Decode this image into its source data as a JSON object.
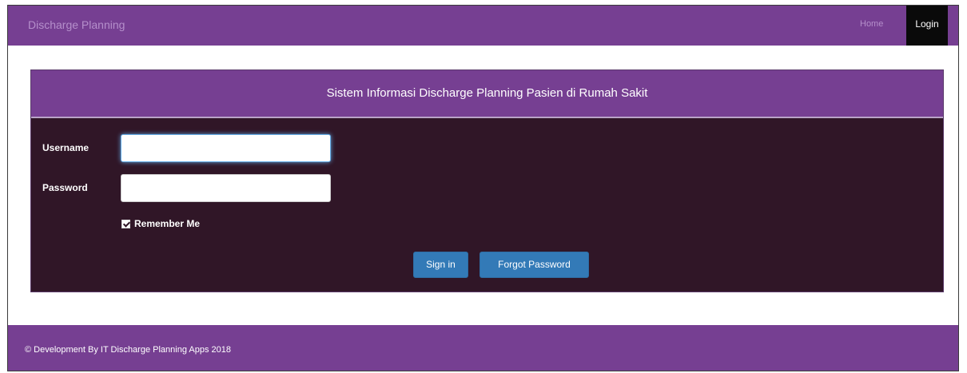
{
  "navbar": {
    "brand": "Discharge Planning",
    "home_label": "Home",
    "login_label": "Login"
  },
  "panel": {
    "title": "Sistem Informasi Discharge Planning Pasien di Rumah Sakit"
  },
  "form": {
    "username_label": "Username",
    "username_value": "",
    "password_label": "Password",
    "password_value": "",
    "remember_label": "Remember Me",
    "remember_checked": true,
    "signin_label": "Sign in",
    "forgot_label": "Forgot Password"
  },
  "footer": {
    "text": "© Development By IT Discharge Planning Apps 2018"
  },
  "colors": {
    "brand_purple": "#763f92",
    "panel_dark": "#301627",
    "button_blue": "#337ab7",
    "login_active": "#0a0a0a"
  },
  "icons": {
    "remember_checkbox": "checkbox-checked-icon"
  }
}
